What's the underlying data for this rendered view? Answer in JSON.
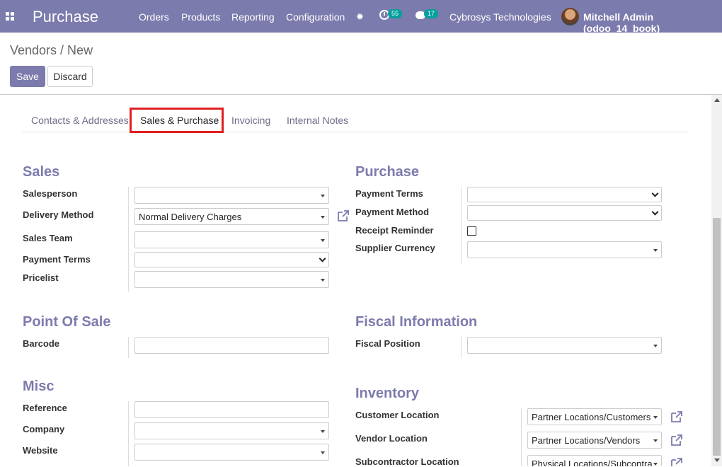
{
  "navbar": {
    "brand": "Purchase",
    "menu": [
      "Orders",
      "Products",
      "Reporting",
      "Configuration"
    ],
    "activity_count": "55",
    "messages_count": "17",
    "company": "Cybrosys Technologies",
    "user": "Mitchell Admin (odoo_14_book)"
  },
  "breadcrumb": "Vendors / New",
  "buttons": {
    "save": "Save",
    "discard": "Discard"
  },
  "tabs": [
    "Contacts & Addresses",
    "Sales & Purchase",
    "Invoicing",
    "Internal Notes"
  ],
  "sales": {
    "title": "Sales",
    "salesperson": "Salesperson",
    "delivery_method": "Delivery Method",
    "delivery_value": "Normal Delivery Charges",
    "sales_team": "Sales Team",
    "payment_terms": "Payment Terms",
    "pricelist": "Pricelist"
  },
  "purchase": {
    "title": "Purchase",
    "payment_terms": "Payment Terms",
    "payment_method": "Payment Method",
    "receipt_reminder": "Receipt Reminder",
    "supplier_currency": "Supplier Currency"
  },
  "pos": {
    "title": "Point Of Sale",
    "barcode": "Barcode"
  },
  "fiscal": {
    "title": "Fiscal Information",
    "fiscal_position": "Fiscal Position"
  },
  "misc": {
    "title": "Misc",
    "reference": "Reference",
    "company": "Company",
    "website": "Website"
  },
  "inventory": {
    "title": "Inventory",
    "customer_location": "Customer Location",
    "customer_value": "Partner Locations/Customers",
    "vendor_location": "Vendor Location",
    "vendor_value": "Partner Locations/Vendors",
    "subcontractor_location": "Subcontractor Location",
    "subcontractor_value": "Physical Locations/Subcontra"
  },
  "colors": {
    "brand": "#7c7bad",
    "badge": "#00a09d",
    "highlight": "#e02020"
  }
}
